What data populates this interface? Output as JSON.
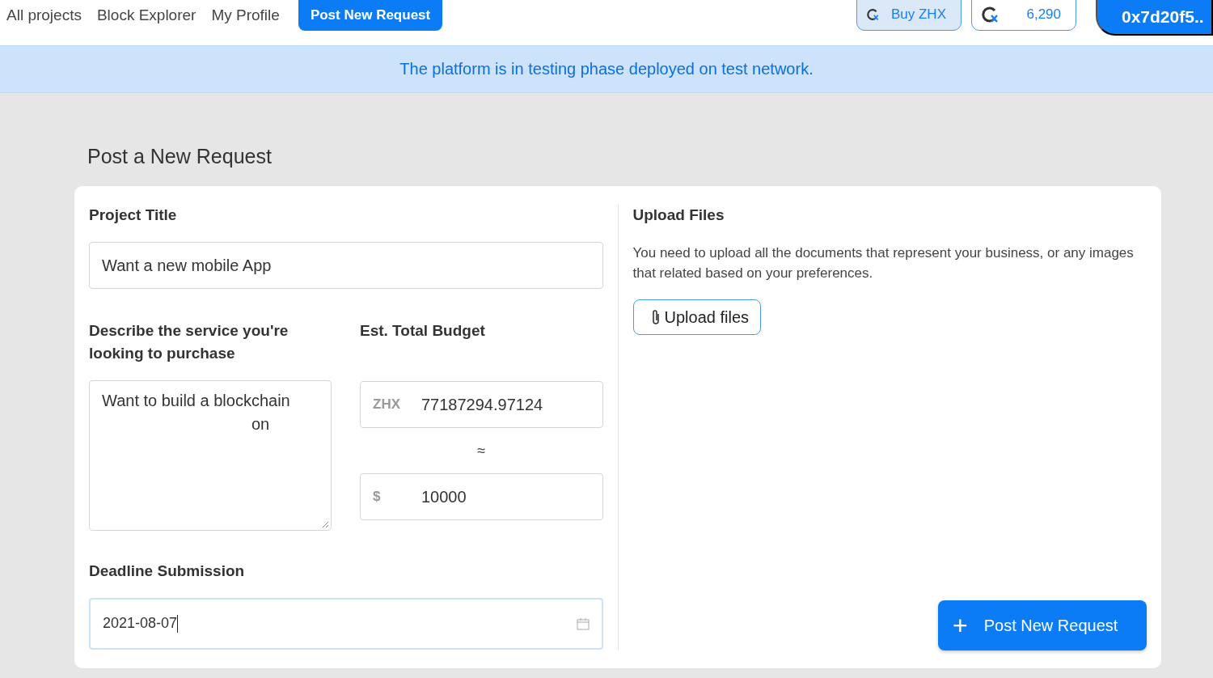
{
  "nav": {
    "links": [
      {
        "label": "All projects",
        "selected": false
      },
      {
        "label": "Block Explorer",
        "selected": false
      },
      {
        "label": "My Profile",
        "selected": false
      },
      {
        "label": "Post New Request",
        "selected": true
      }
    ],
    "buy_button": "Buy ZHX",
    "balance": "6,290",
    "wallet": "0x7d20f5.."
  },
  "banner": "The platform is in testing phase deployed on test network.",
  "page_title": "Post a New Request",
  "form": {
    "project_title": {
      "label": "Project Title",
      "value": "Want a new mobile App"
    },
    "description": {
      "label": "Describe the service you're looking to purchase",
      "lines": [
        "Want to build a blockchain",
        "on"
      ]
    },
    "budget": {
      "label": "Est. Total Budget",
      "zhx_prefix": "ZHX",
      "zhx_value": "77187294.97124",
      "approx": "≈",
      "usd_prefix": "$",
      "usd_value": "10000"
    },
    "deadline": {
      "label": "Deadline Submission",
      "value": "2021-08-07",
      "focused": true
    }
  },
  "upload": {
    "title": "Upload Files",
    "text": "You need to upload all the documents that represent your business, or any images that related based on your preferences.",
    "button": "Upload files"
  },
  "submit": {
    "icon": "+",
    "label": "Post New Request"
  }
}
